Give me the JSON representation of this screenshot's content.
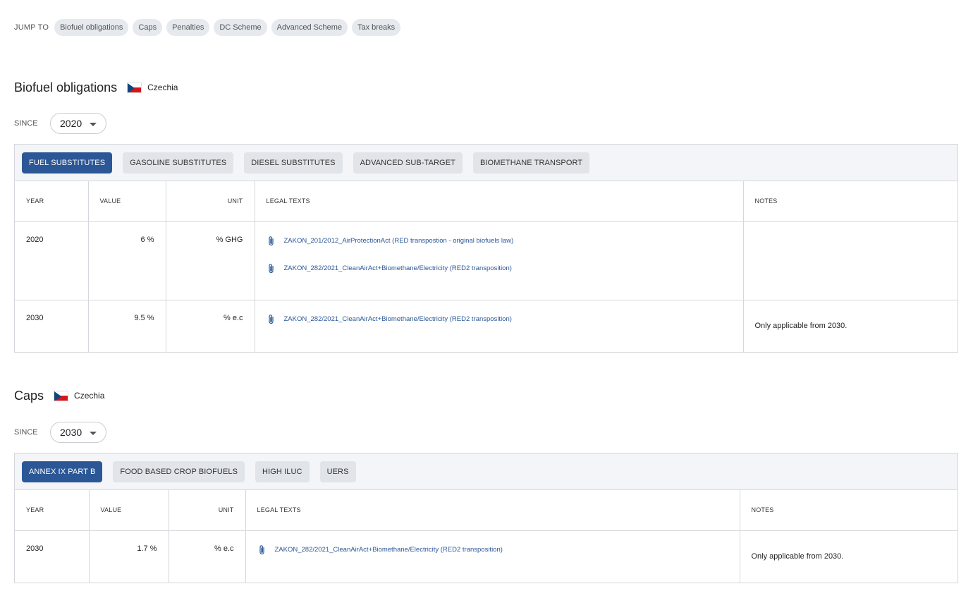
{
  "jump": {
    "label": "JUMP TO",
    "chips": [
      "Biofuel obligations",
      "Caps",
      "Penalties",
      "DC Scheme",
      "Advanced Scheme",
      "Tax breaks"
    ]
  },
  "sections": [
    {
      "title": "Biofuel obligations",
      "country": "Czechia",
      "since_label": "SINCE",
      "since_value": "2020",
      "tabs": [
        "FUEL SUBSTITUTES",
        "GASOLINE SUBSTITUTES",
        "DIESEL SUBSTITUTES",
        "ADVANCED SUB-TARGET",
        "BIOMETHANE TRANSPORT"
      ],
      "active_tab": 0,
      "columns": [
        "YEAR",
        "VALUE",
        "UNIT",
        "LEGAL TEXTS",
        "NOTES"
      ],
      "rows": [
        {
          "year": "2020",
          "value": "6 %",
          "unit": "% GHG",
          "legal": [
            "ZAKON_201/2012_AirProtectionAct (RED transpostion - original biofuels law)",
            "ZAKON_282/2021_CleanAirAct+Biomethane/Electricity (RED2 transposition)"
          ],
          "notes": ""
        },
        {
          "year": "2030",
          "value": "9.5 %",
          "unit": "% e.c",
          "legal": [
            "ZAKON_282/2021_CleanAirAct+Biomethane/Electricity (RED2 transposition)"
          ],
          "notes": "Only applicable from 2030."
        }
      ]
    },
    {
      "title": "Caps",
      "country": "Czechia",
      "since_label": "SINCE",
      "since_value": "2030",
      "tabs": [
        "ANNEX IX PART B",
        "FOOD BASED CROP BIOFUELS",
        "HIGH ILUC",
        "UERS"
      ],
      "active_tab": 0,
      "columns": [
        "YEAR",
        "VALUE",
        "UNIT",
        "LEGAL TEXTS",
        "NOTES"
      ],
      "rows": [
        {
          "year": "2030",
          "value": "1.7 %",
          "unit": "% e.c",
          "legal": [
            "ZAKON_282/2021_CleanAirAct+Biomethane/Electricity (RED2 transposition)"
          ],
          "notes": "Only applicable from 2030."
        }
      ]
    }
  ],
  "colors": {
    "accent": "#2b5797",
    "chip_bg": "#e6e9ed",
    "tabbar_bg": "#f3f5f8",
    "border": "#d4d7db"
  },
  "icons": {
    "legal_link": "paperclip-icon",
    "select": "chevron-down-icon",
    "flag": "czech-flag-icon"
  }
}
